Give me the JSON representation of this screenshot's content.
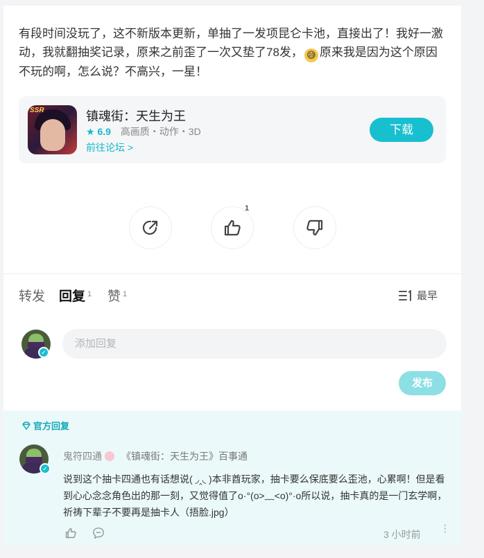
{
  "post": {
    "text_part1": "有段时间没玩了，这不新版本更新，单抽了一发项昆仑卡池，直接出了！我好一激动，我就翻抽奖记录，原来之前歪了一次又垫了78发，",
    "emoji": "😅",
    "text_part2": "原来我是因为这个原因不玩的啊，怎么说？不高兴，一星！"
  },
  "game": {
    "icon_tag": "SSR",
    "title": "镇魂街：天生为王",
    "star": "★",
    "rating": "6.9",
    "tags": "高画质・动作・3D",
    "forum_link": "前往论坛 >",
    "download_label": "下载"
  },
  "actions": {
    "like_count": "1"
  },
  "tabs": {
    "repost": "转发",
    "reply": "回复",
    "reply_count": "1",
    "like": "赞",
    "like_count": "1",
    "sort_label": "最早"
  },
  "reply_box": {
    "placeholder": "添加回复",
    "publish_label": "发布"
  },
  "official_reply": {
    "label": "官方回复",
    "username": "鬼符四通",
    "game_ref": "《镇魂街：天生为王》百事通",
    "text": "说到这个抽卡四通也有话想说( ◞‸◟ )本非酋玩家，抽卡要么保底要么歪池，心累啊！但是看到心心念念角色出的那一刻，又觉得值了o·°(o>﹏<o)°·o所以说，抽卡真的是一门玄学啊，祈祷下辈子不要再是抽卡人（捂脸.jpg）",
    "time": "3 小时前",
    "more": "⋮"
  }
}
